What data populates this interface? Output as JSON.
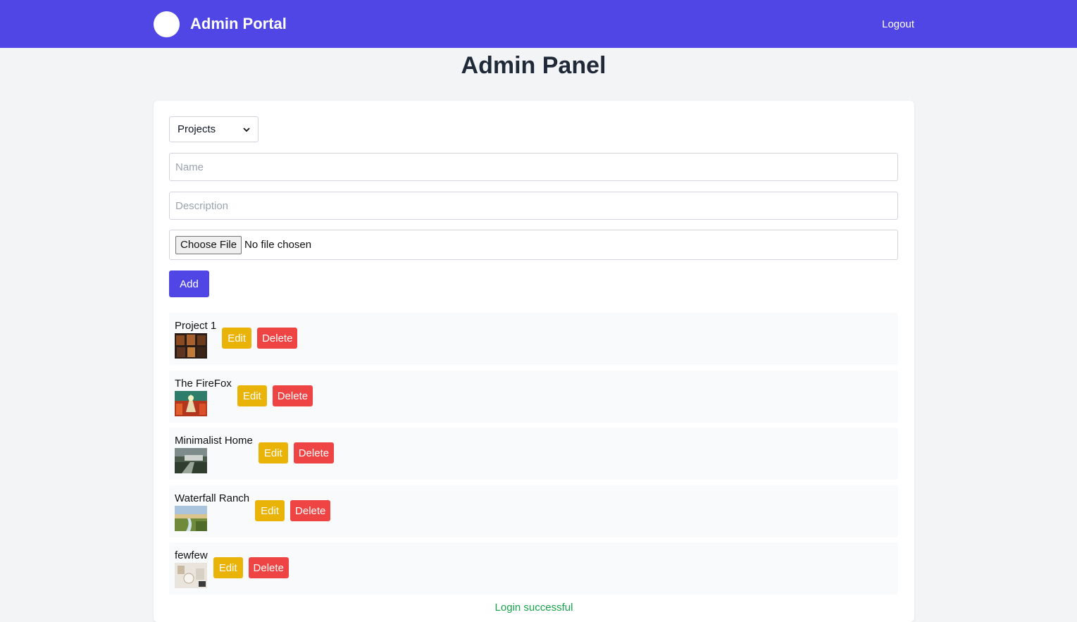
{
  "header": {
    "title": "Admin Portal",
    "logout_label": "Logout"
  },
  "page": {
    "title": "Admin Panel"
  },
  "form": {
    "category_selected": "Projects",
    "name_placeholder": "Name",
    "description_placeholder": "Description",
    "file_button_label": "Choose File",
    "file_status": "No file chosen",
    "add_label": "Add"
  },
  "items": [
    {
      "name": "Project 1",
      "edit_label": "Edit",
      "delete_label": "Delete"
    },
    {
      "name": "The FireFox",
      "edit_label": "Edit",
      "delete_label": "Delete"
    },
    {
      "name": "Minimalist Home",
      "edit_label": "Edit",
      "delete_label": "Delete"
    },
    {
      "name": "Waterfall Ranch",
      "edit_label": "Edit",
      "delete_label": "Delete"
    },
    {
      "name": "fewfew",
      "edit_label": "Edit",
      "delete_label": "Delete"
    }
  ],
  "status": {
    "message": "Login successful"
  },
  "colors": {
    "primary": "#4f46e5",
    "edit": "#eab308",
    "delete": "#ef4444",
    "success": "#16a34a"
  }
}
